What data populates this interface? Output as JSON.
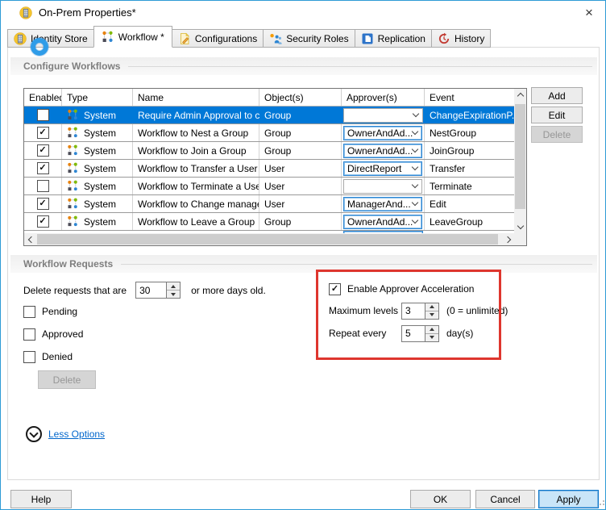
{
  "window": {
    "title": "On-Prem Properties*",
    "close_glyph": "×"
  },
  "tabs": [
    {
      "id": "identity-store",
      "label": "Identity Store",
      "icon": "icon-identity-store",
      "selected": false
    },
    {
      "id": "workflow",
      "label": "Workflow *",
      "icon": "icon-workflow",
      "selected": true
    },
    {
      "id": "configurations",
      "label": "Configurations",
      "icon": "icon-configurations",
      "selected": false
    },
    {
      "id": "security-roles",
      "label": "Security Roles",
      "icon": "icon-security-roles",
      "selected": false
    },
    {
      "id": "replication",
      "label": "Replication",
      "icon": "icon-replication",
      "selected": false
    },
    {
      "id": "history",
      "label": "History",
      "icon": "icon-history",
      "selected": false
    }
  ],
  "configure_workflows": {
    "section_title": "Configure Workflows",
    "columns": [
      "Enabled",
      "Type",
      "Name",
      "Object(s)",
      "Approver(s)",
      "Event"
    ],
    "rows": [
      {
        "enabled": false,
        "selected": true,
        "type": "System",
        "name": "Require Admin Approval to c...",
        "object": "Group",
        "approver": "",
        "event": "ChangeExpirationP."
      },
      {
        "enabled": true,
        "selected": false,
        "type": "System",
        "name": "Workflow to Nest a Group",
        "object": "Group",
        "approver": "OwnerAndAd...",
        "event": "NestGroup"
      },
      {
        "enabled": true,
        "selected": false,
        "type": "System",
        "name": "Workflow to Join a Group",
        "object": "Group",
        "approver": "OwnerAndAd...",
        "event": "JoinGroup"
      },
      {
        "enabled": true,
        "selected": false,
        "type": "System",
        "name": "Workflow to Transfer a User",
        "object": "User",
        "approver": "DirectReport",
        "event": "Transfer"
      },
      {
        "enabled": false,
        "selected": false,
        "type": "System",
        "name": "Workflow to Terminate a User",
        "object": "User",
        "approver": "",
        "event": "Terminate"
      },
      {
        "enabled": true,
        "selected": false,
        "type": "System",
        "name": "Workflow to Change manager",
        "object": "User",
        "approver": "ManagerAnd...",
        "event": "Edit"
      },
      {
        "enabled": true,
        "selected": false,
        "type": "System",
        "name": "Workflow to Leave a Group",
        "object": "Group",
        "approver": "OwnerAndAd...",
        "event": "LeaveGroup"
      }
    ],
    "buttons": {
      "add": "Add",
      "edit": "Edit",
      "delete": "Delete"
    }
  },
  "workflow_requests": {
    "section_title": "Workflow Requests",
    "delete_prefix": "Delete requests that are",
    "days_value": "30",
    "delete_suffix": "or more days old.",
    "status_checkboxes": [
      {
        "label": "Pending",
        "checked": false
      },
      {
        "label": "Approved",
        "checked": false
      },
      {
        "label": "Denied",
        "checked": false
      }
    ],
    "delete_button": "Delete",
    "acceleration": {
      "enable_label": "Enable Approver Acceleration",
      "enabled": true,
      "max_levels_label": "Maximum levels",
      "max_levels_value": "3",
      "max_levels_hint": "(0 = unlimited)",
      "repeat_label": "Repeat every",
      "repeat_value": "5",
      "repeat_hint": "day(s)"
    }
  },
  "less_options_label": "Less Options",
  "footer": {
    "help": "Help",
    "ok": "OK",
    "cancel": "Cancel",
    "apply": "Apply"
  },
  "colors": {
    "selection": "#0078D7",
    "highlight_box": "#DE362E",
    "link": "#0066CC",
    "window_border": "#2E9BD6",
    "apply_bg": "#C9E5F8",
    "apply_border": "#0A74C9"
  }
}
